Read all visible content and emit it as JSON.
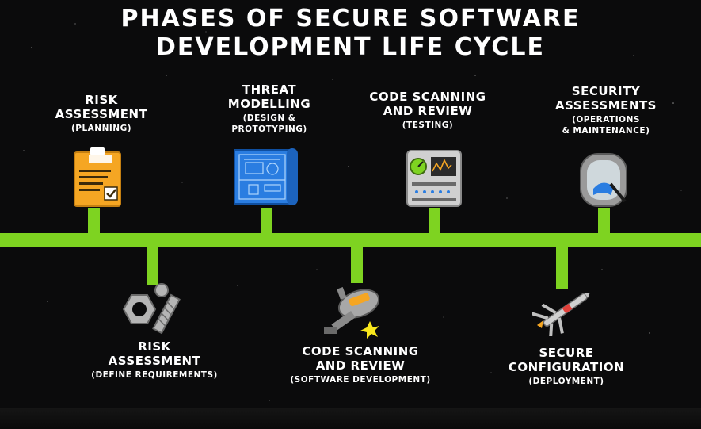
{
  "title_line1": "PHASES OF SECURE SOFTWARE",
  "title_line2": "DEVELOPMENT LIFE CYCLE",
  "top_phases": [
    {
      "title_lines": [
        "RISK",
        "ASSESSMENT"
      ],
      "sub_lines": [
        "(PLANNING)"
      ],
      "icon": "clipboard-checklist-icon"
    },
    {
      "title_lines": [
        "THREAT",
        "MODELLING"
      ],
      "sub_lines": [
        "(DESIGN &",
        "PROTOTYPING)"
      ],
      "icon": "blueprint-icon"
    },
    {
      "title_lines": [
        "CODE SCANNING",
        "AND REVIEW"
      ],
      "sub_lines": [
        "(TESTING)"
      ],
      "icon": "control-panel-icon"
    },
    {
      "title_lines": [
        "SECURITY",
        "ASSESSMENTS"
      ],
      "sub_lines": [
        "(OPERATIONS",
        "& MAINTENANCE)"
      ],
      "icon": "window-cleaning-icon"
    }
  ],
  "bottom_phases": [
    {
      "title_lines": [
        "RISK",
        "ASSESSMENT"
      ],
      "sub_lines": [
        "(DEFINE REQUIREMENTS)"
      ],
      "icon": "nut-and-bolt-icon"
    },
    {
      "title_lines": [
        "CODE SCANNING",
        "AND REVIEW"
      ],
      "sub_lines": [
        "(SOFTWARE DEVELOPMENT)"
      ],
      "icon": "droid-welding-icon"
    },
    {
      "title_lines": [
        "SECURE",
        "CONFIGURATION"
      ],
      "sub_lines": [
        "(DEPLOYMENT)"
      ],
      "icon": "starfighter-icon"
    }
  ],
  "colors": {
    "background": "#0b0b0c",
    "timeline": "#7ed321",
    "text": "#ffffff"
  }
}
